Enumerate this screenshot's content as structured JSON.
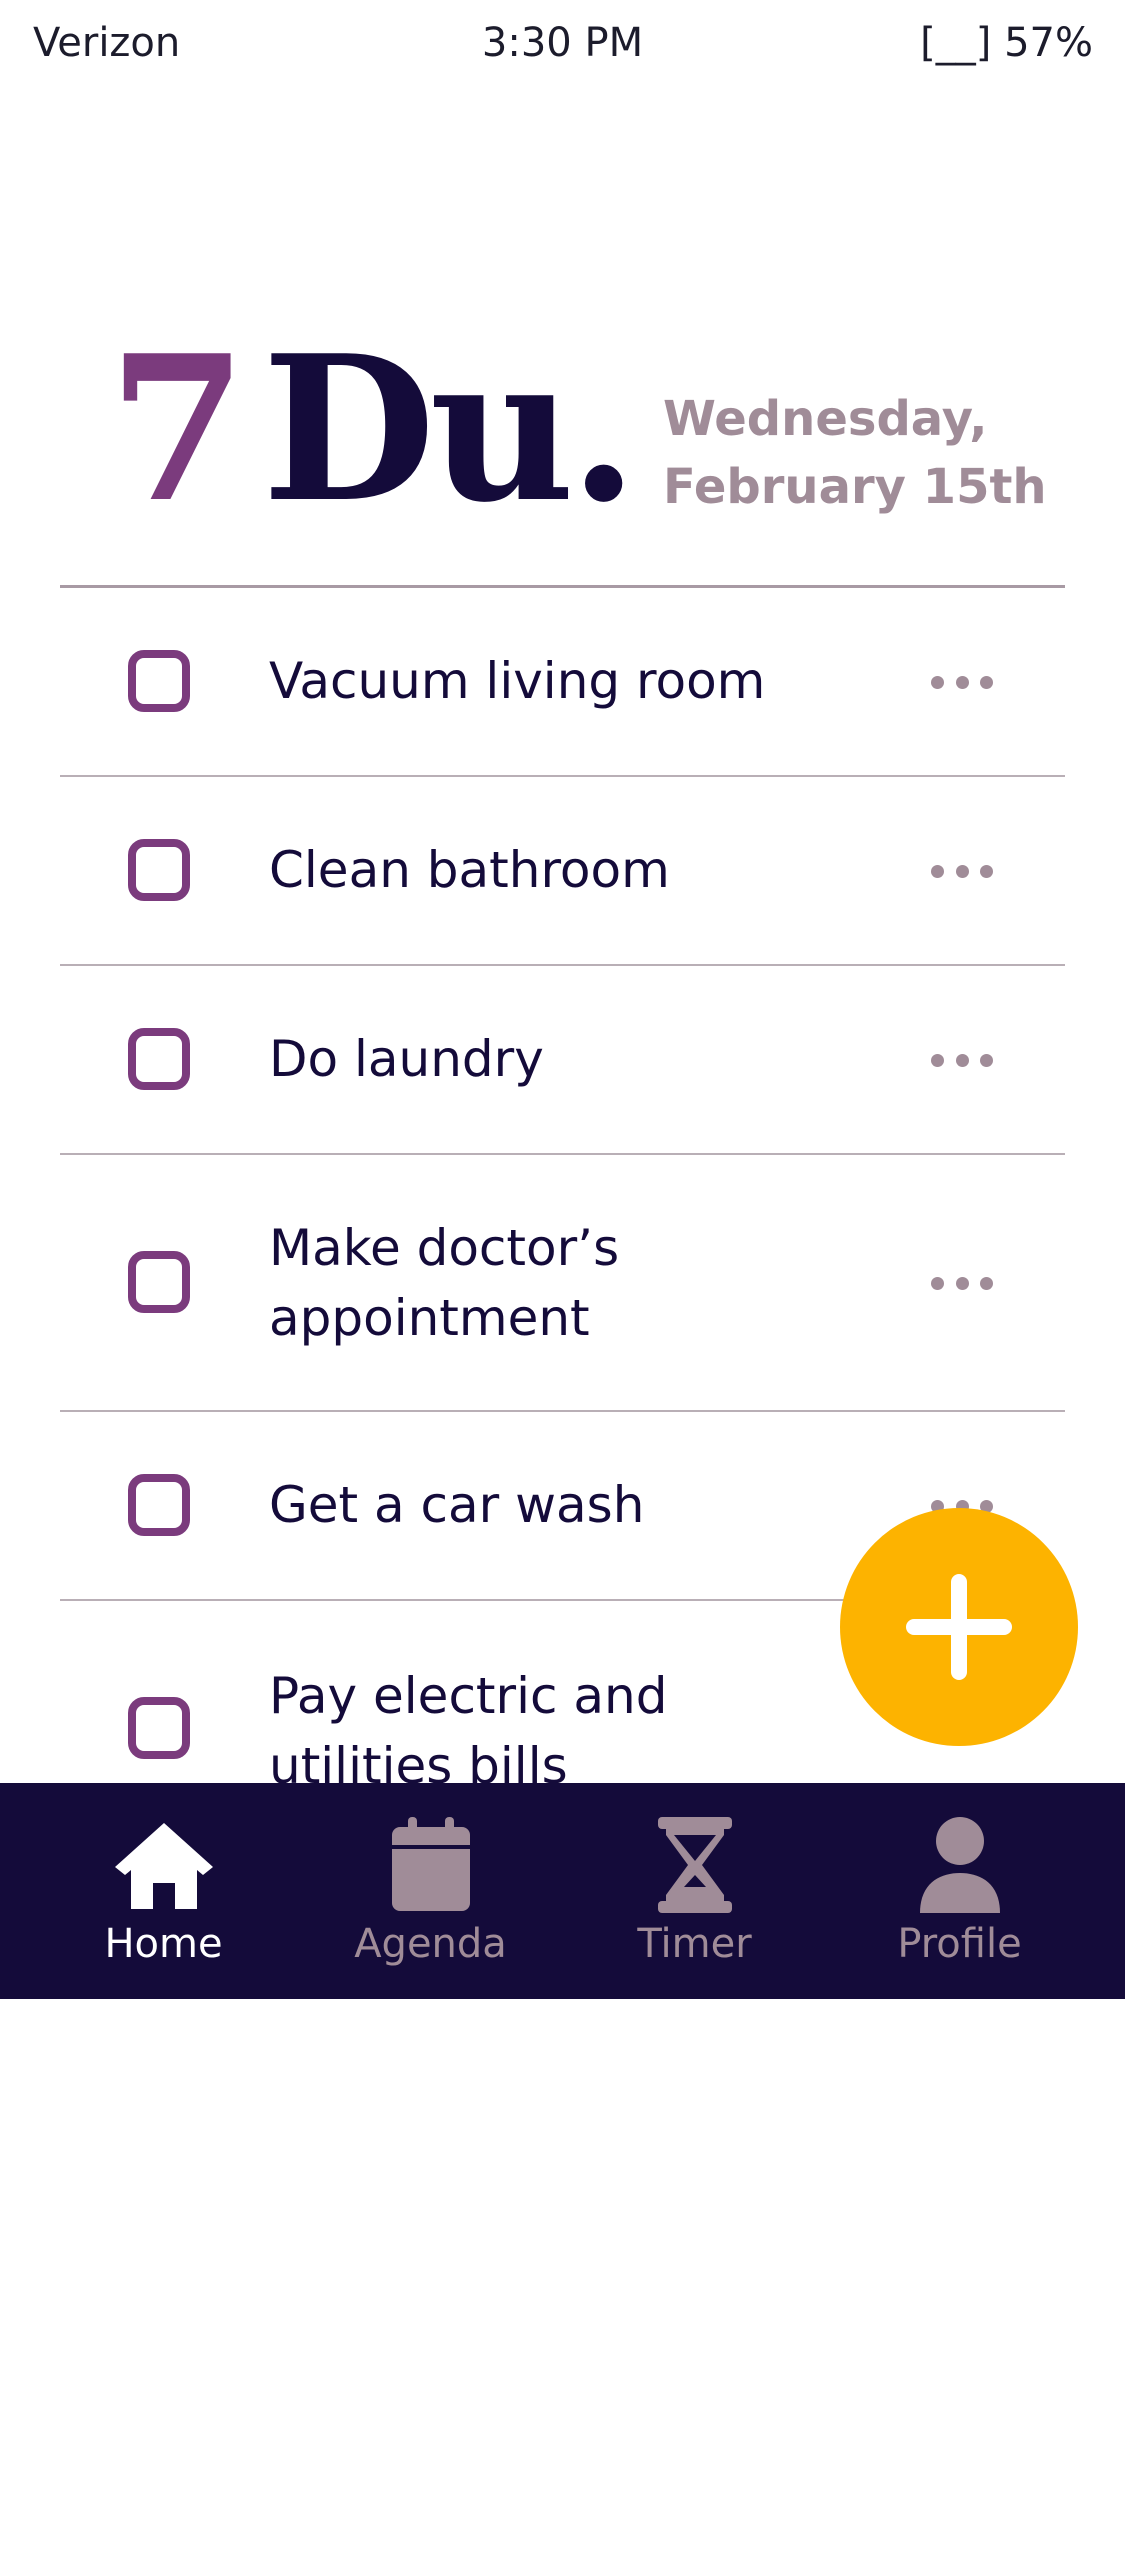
{
  "status_bar": {
    "carrier": "Verizon",
    "time": "3:30 PM",
    "battery": "[__] 57%"
  },
  "header": {
    "logo_number": "7",
    "logo_word": "Du.",
    "date_line1": "Wednesday,",
    "date_line2": "February 15th"
  },
  "tasks": [
    {
      "label": "Vacuum living room",
      "checked": false
    },
    {
      "label": "Clean bathroom",
      "checked": false
    },
    {
      "label": "Do laundry",
      "checked": false
    },
    {
      "label": "Make doctor’s appointment",
      "checked": false
    },
    {
      "label": "Get a car wash",
      "checked": false
    },
    {
      "label": "Pay electric and utilities bills",
      "checked": false
    }
  ],
  "fab": {
    "icon": "plus-icon",
    "color": "#fdb300"
  },
  "bottom_nav": {
    "items": [
      {
        "label": "Home",
        "icon": "home-icon",
        "active": true
      },
      {
        "label": "Agenda",
        "icon": "calendar-icon",
        "active": false
      },
      {
        "label": "Timer",
        "icon": "hourglass-icon",
        "active": false
      },
      {
        "label": "Profile",
        "icon": "person-icon",
        "active": false
      }
    ]
  },
  "colors": {
    "brand_dark": "#140b3a",
    "brand_purple": "#7b3b7d",
    "muted": "#a08c98",
    "accent": "#fdb300"
  }
}
